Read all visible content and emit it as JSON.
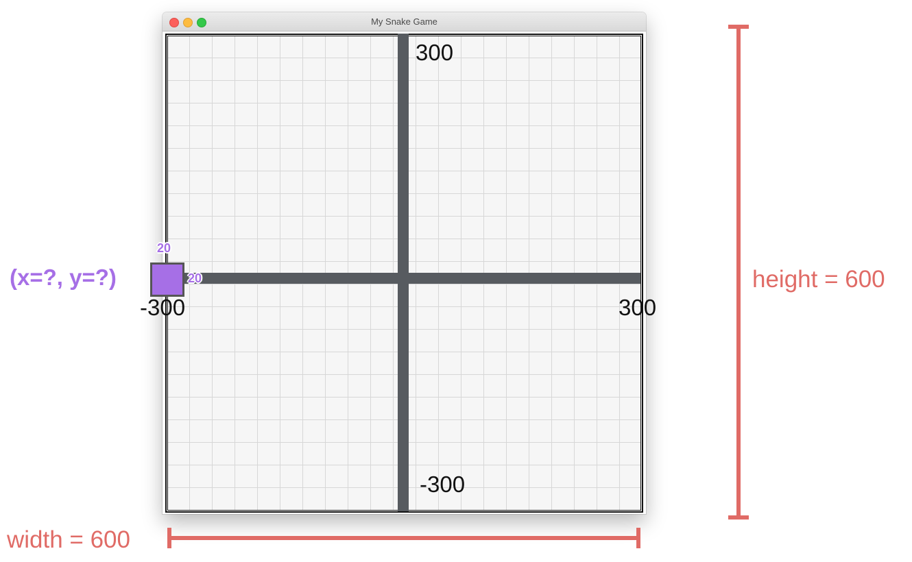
{
  "window": {
    "title": "My Snake Game"
  },
  "axes": {
    "top_label": "300",
    "bottom_label": "-300",
    "left_label": "-300",
    "right_label": "300"
  },
  "snake_segment": {
    "size_top": "20",
    "size_right": "20",
    "coord_label": "(x=?, y=?)"
  },
  "dimensions": {
    "height_label": "height = 600",
    "width_label": "width = 600"
  },
  "colors": {
    "axis": "#575b60",
    "snake_fill": "#a66fe6",
    "annotation": "#e06b66"
  }
}
